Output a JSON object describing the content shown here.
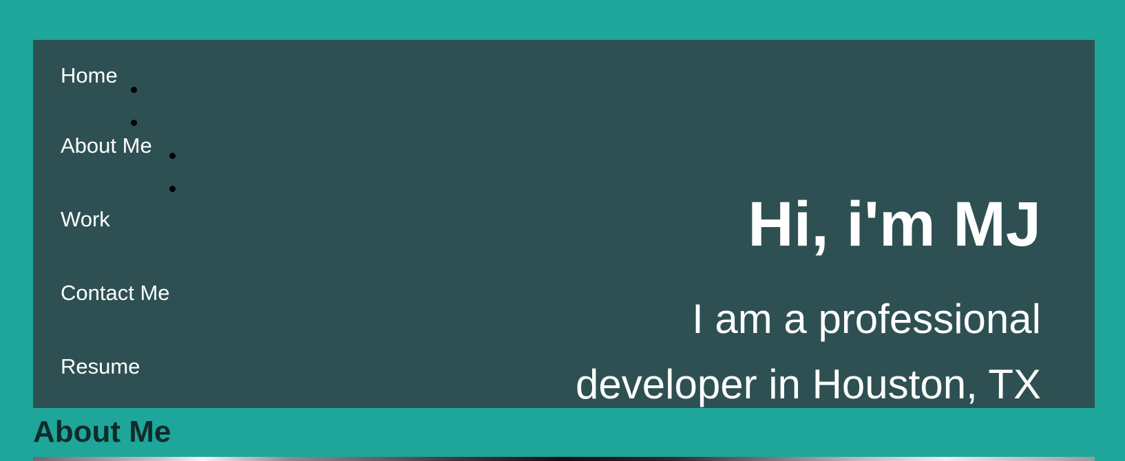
{
  "nav": {
    "items": [
      {
        "label": "Home"
      },
      {
        "label": "About Me"
      },
      {
        "label": "Work"
      },
      {
        "label": "Contact Me"
      },
      {
        "label": "Resume"
      }
    ]
  },
  "hero": {
    "title": "Hi, i'm MJ",
    "tagline": "I am a professional developer in Houston, TX"
  },
  "about": {
    "heading": "About Me"
  },
  "colors": {
    "page_background": "#1ea69b",
    "header_background": "#2e5052",
    "text_light": "#ffffff",
    "heading_dark": "#0f2b2a"
  }
}
